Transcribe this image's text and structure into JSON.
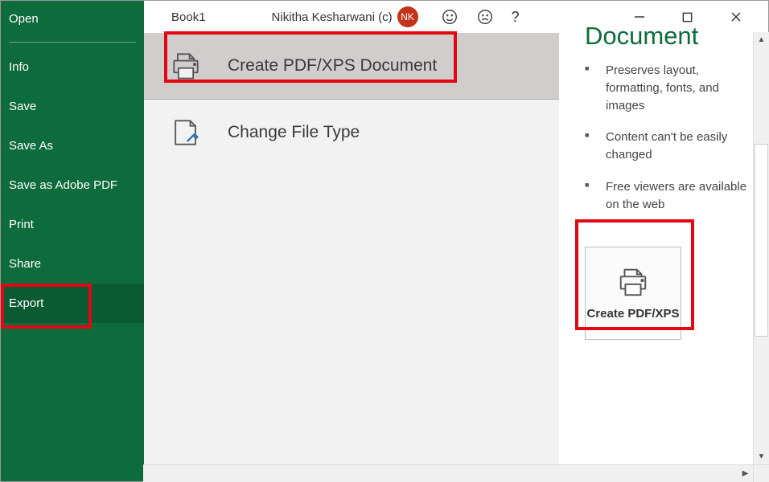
{
  "titlebar": {
    "book_name": "Book1",
    "user_name": "Nikitha Kesharwani (c)",
    "avatar_initials": "NK"
  },
  "sidebar": {
    "items": [
      {
        "label": "Open"
      },
      {
        "label": "Info"
      },
      {
        "label": "Save"
      },
      {
        "label": "Save As"
      },
      {
        "label": "Save as Adobe PDF"
      },
      {
        "label": "Print"
      },
      {
        "label": "Share"
      },
      {
        "label": "Export"
      }
    ]
  },
  "options": {
    "create_pdf": "Create PDF/XPS Document",
    "change_type": "Change File Type"
  },
  "details": {
    "title": "Document",
    "bullets": [
      "Preserves layout, formatting, fonts, and images",
      "Content can't be easily changed",
      "Free viewers are available on the web"
    ],
    "button_label": "Create PDF/XPS"
  }
}
